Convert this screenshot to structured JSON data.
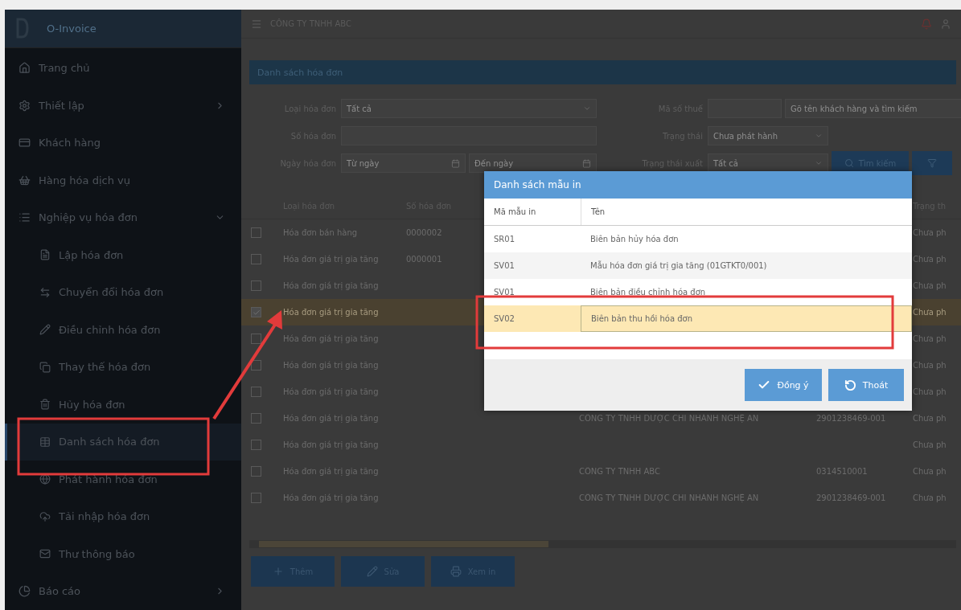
{
  "sidebar": {
    "logo": "O-Invoice",
    "items": [
      {
        "label": "Trang chủ",
        "selected": false
      },
      {
        "label": "Thiết lập",
        "selected": false,
        "expanded": false
      },
      {
        "label": "Khách hàng",
        "selected": false
      },
      {
        "label": "Hàng hóa dịch vụ",
        "selected": false
      },
      {
        "label": "Nghiệp vụ hóa đơn",
        "selected": false,
        "expanded": true,
        "children": [
          {
            "label": "Lập hóa đơn",
            "selected": false
          },
          {
            "label": "Chuyển đổi hóa đơn",
            "selected": false
          },
          {
            "label": "Điều chỉnh hóa đơn",
            "selected": false
          },
          {
            "label": "Thay thế hóa đơn",
            "selected": false
          },
          {
            "label": "Hủy hóa đơn",
            "selected": false
          },
          {
            "label": "Danh sách hóa đơn",
            "selected": true
          },
          {
            "label": "Phát hành hóa đơn",
            "selected": false
          },
          {
            "label": "Tải nhập hóa đơn",
            "selected": false
          },
          {
            "label": "Thư thông báo",
            "selected": false
          }
        ]
      },
      {
        "label": "Báo cáo",
        "selected": false,
        "expanded": false
      }
    ]
  },
  "header": {
    "company": "CÔNG TY TNHH ABC"
  },
  "panel": {
    "title": "Danh sách hóa đơn"
  },
  "filters": {
    "invoice_type": {
      "label": "Loại hóa đơn",
      "value": "Tất cả"
    },
    "tax_code": {
      "label": "Mã số thuế"
    },
    "customer": {
      "placeholder": "Gõ tên khách hàng và tìm kiếm"
    },
    "invoice_no": {
      "label": "Số hóa đơn"
    },
    "status": {
      "label": "Trạng thái",
      "value": "Chưa phát hành"
    },
    "date": {
      "label": "Ngày hóa đơn",
      "from_placeholder": "Từ ngày",
      "to_placeholder": "Đến ngày"
    },
    "export_status": {
      "label": "Trạng thái xuất",
      "value": "Tất cả"
    },
    "search_button": "Tìm kiếm"
  },
  "table": {
    "columns": {
      "invoice_type": "Loại hóa đơn",
      "invoice_no": "Số hóa đơn",
      "status": "Trạng th"
    },
    "rows": [
      {
        "checked": false,
        "selected": false,
        "type": "Hóa đơn bán hàng",
        "number": "0000002",
        "status": "Chưa ph"
      },
      {
        "checked": false,
        "selected": false,
        "type": "Hóa đơn giá trị gia tăng",
        "number": "0000001",
        "status": "Chưa ph"
      },
      {
        "checked": false,
        "selected": false,
        "type": "Hóa đơn giá trị gia tăng",
        "status": "Chưa ph"
      },
      {
        "checked": true,
        "selected": true,
        "type": "Hóa đơn giá trị gia tăng",
        "status": "Chưa ph"
      },
      {
        "checked": false,
        "selected": false,
        "type": "Hóa đơn giá trị gia tăng",
        "status": "Chưa ph"
      },
      {
        "checked": false,
        "selected": false,
        "type": "Hóa đơn giá trị gia tăng",
        "status": "Chưa ph"
      },
      {
        "checked": false,
        "selected": false,
        "type": "Hóa đơn giá trị gia tăng",
        "status": "Chưa ph"
      },
      {
        "checked": false,
        "selected": false,
        "type": "Hóa đơn giá trị gia tăng",
        "customer": "CÔNG TY TNHH DƯỢC CHI NHÁNH NGHỆ AN",
        "tax_code": "2901238469-001",
        "status": "Chưa ph"
      },
      {
        "checked": false,
        "selected": false,
        "type": "Hóa đơn giá trị gia tăng",
        "status": "Chưa ph"
      },
      {
        "checked": false,
        "selected": false,
        "type": "Hóa đơn giá trị gia tăng",
        "customer": "CÔNG TY TNHH ABC",
        "tax_code": "0314510001",
        "status": "Chưa ph"
      },
      {
        "checked": false,
        "selected": false,
        "type": "Hóa đơn giá trị gia tăng",
        "customer": "CÔNG TY TNHH DƯỢC CHI NHÁNH NGHỆ AN",
        "tax_code": "2901238469-001",
        "status": "Chưa ph"
      }
    ]
  },
  "actions": [
    "Thêm",
    "Sửa",
    "Xem in"
  ],
  "dialog": {
    "title": "Danh sách mẫu in",
    "columns": [
      "Mã mẫu in",
      "Tên"
    ],
    "rows": [
      {
        "code": "SR01",
        "name": "Biên bản hủy hóa đơn",
        "selected": false
      },
      {
        "code": "SV01",
        "name": "Mẫu hóa đơn giá trị gia tăng (01GTKT0/001)",
        "selected": false
      },
      {
        "code": "SV01",
        "name": "Biên bản điều chỉnh hóa đơn",
        "selected": false
      },
      {
        "code": "SV02",
        "name": "Biên bản thu hồi hóa đơn",
        "selected": true
      }
    ],
    "buttons": [
      "Đồng ý",
      "Thoát"
    ]
  }
}
